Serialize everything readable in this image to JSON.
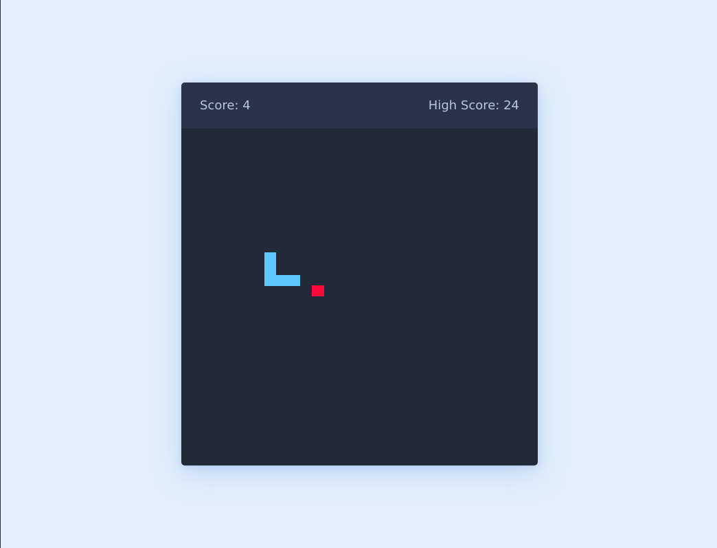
{
  "header": {
    "score_label": "Score: 4",
    "high_score_label": "High Score: 24"
  },
  "game": {
    "score": 4,
    "high_score": 24,
    "snake_segments": [
      {
        "col": 0,
        "row": 0
      },
      {
        "col": 0,
        "row": 1
      },
      {
        "col": 0,
        "row": 2
      },
      {
        "col": 1,
        "row": 2
      },
      {
        "col": 2,
        "row": 2
      }
    ],
    "food": {
      "col": 4,
      "row": 3
    }
  },
  "colors": {
    "page_background": "#e3f0fc",
    "board": "#222939",
    "header": "#29344a",
    "header_text": "#b7c6de",
    "snake": "#5cc8fb",
    "food": "#ff0a3a"
  }
}
